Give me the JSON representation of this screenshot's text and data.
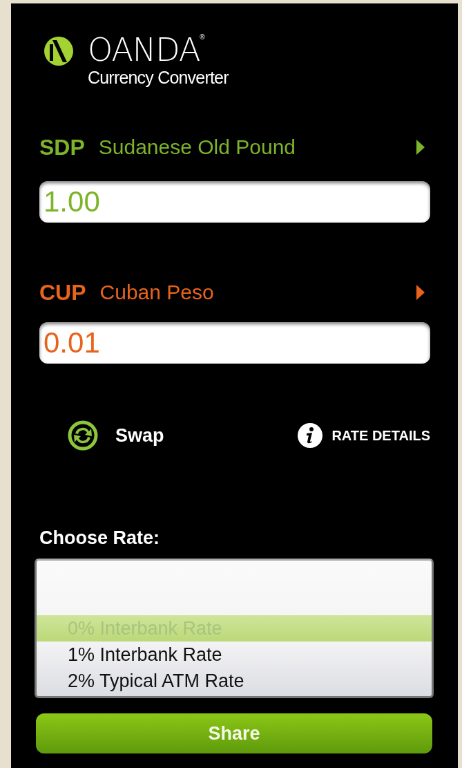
{
  "header": {
    "brand": "OANDA",
    "brand_mark": "®",
    "subtitle": "Currency Converter"
  },
  "currencies": [
    {
      "code": "SDP",
      "name": "Sudanese Old Pound",
      "value": "1.00",
      "color": "#7db42a"
    },
    {
      "code": "CUP",
      "name": "Cuban Peso",
      "value": "0.01",
      "color": "#e8641c"
    }
  ],
  "actions": {
    "swap": "Swap",
    "details": "RATE DETAILS"
  },
  "rate_picker": {
    "label": "Choose Rate:",
    "options": [
      {
        "label": "0% Interbank Rate",
        "selected": true
      },
      {
        "label": "1% Interbank Rate",
        "selected": false
      },
      {
        "label": "2% Typical ATM Rate",
        "selected": false
      }
    ]
  },
  "share_button": "Share"
}
